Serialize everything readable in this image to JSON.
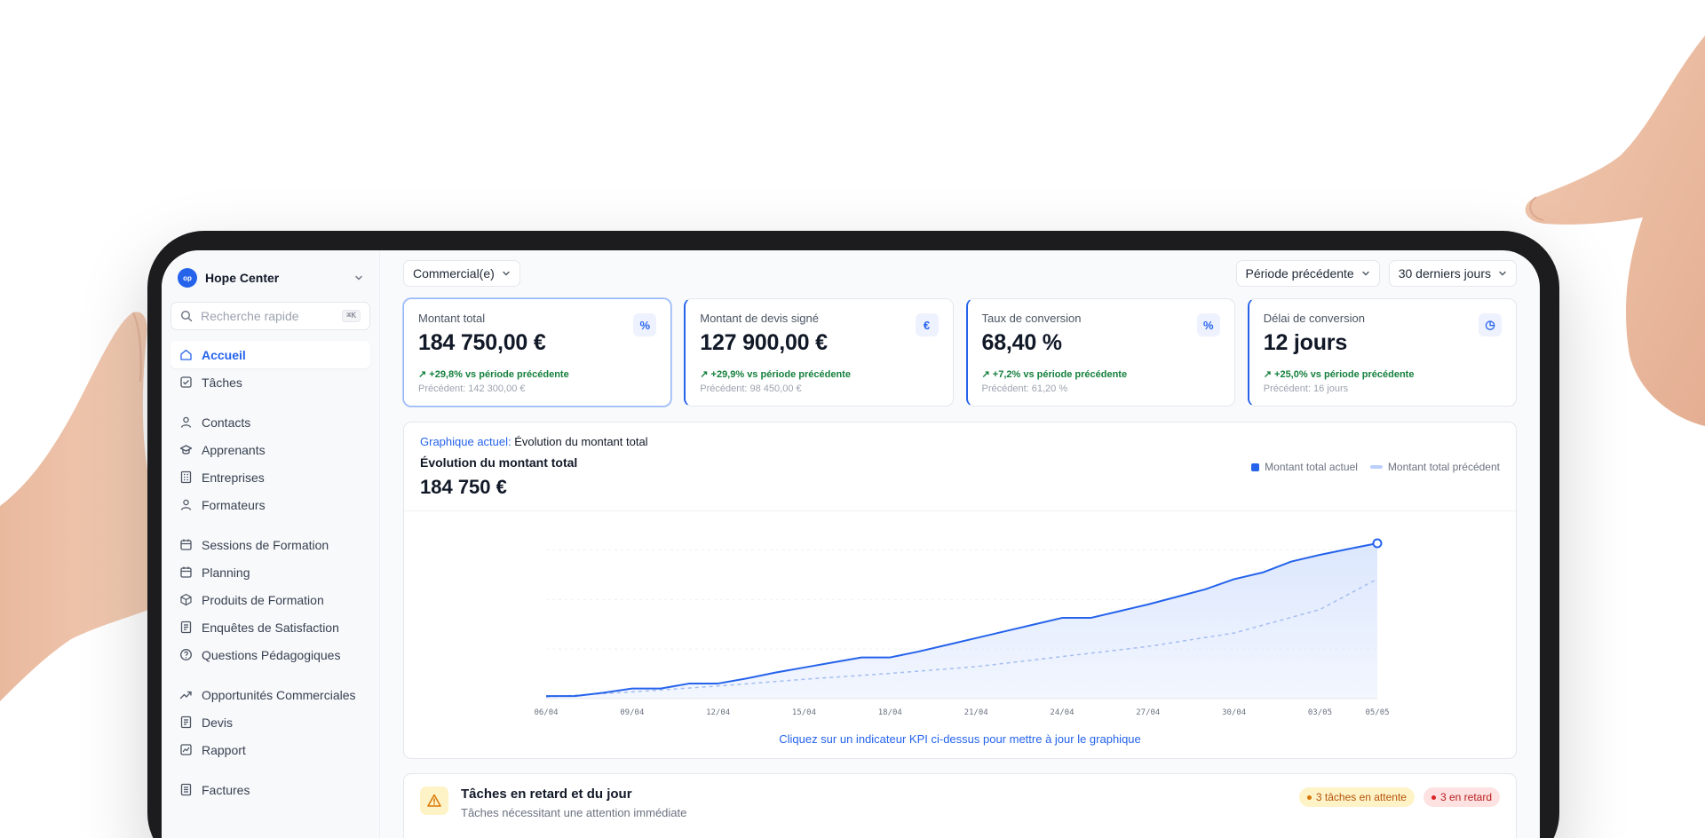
{
  "sidebar": {
    "org_logo": "op",
    "org_name": "Hope Center",
    "search_placeholder": "Recherche rapide",
    "search_shortcut": "⌘K",
    "groups": [
      [
        {
          "label": "Accueil",
          "icon": "home-icon",
          "active": true
        },
        {
          "label": "Tâches",
          "icon": "checkbox-icon"
        }
      ],
      [
        {
          "label": "Contacts",
          "icon": "user-icon"
        },
        {
          "label": "Apprenants",
          "icon": "graduation-cap-icon"
        },
        {
          "label": "Entreprises",
          "icon": "building-icon"
        },
        {
          "label": "Formateurs",
          "icon": "user-icon"
        }
      ],
      [
        {
          "label": "Sessions de Formation",
          "icon": "calendar-icon"
        },
        {
          "label": "Planning",
          "icon": "calendar-icon"
        },
        {
          "label": "Produits de Formation",
          "icon": "box-icon"
        },
        {
          "label": "Enquêtes de Satisfaction",
          "icon": "document-icon"
        },
        {
          "label": "Questions Pédagogiques",
          "icon": "help-circle-icon"
        }
      ],
      [
        {
          "label": "Opportunités Commerciales",
          "icon": "trending-up-icon"
        },
        {
          "label": "Devis",
          "icon": "document-icon"
        },
        {
          "label": "Rapport",
          "icon": "line-chart-icon"
        }
      ],
      [
        {
          "label": "Factures",
          "icon": "invoice-icon"
        }
      ]
    ]
  },
  "topbar": {
    "commercial_filter": "Commercial(e)",
    "compare_period": "Période précédente",
    "date_range": "30 derniers jours"
  },
  "kpis": [
    {
      "label": "Montant total",
      "value": "184 750,00 €",
      "delta": "↗ +29,8% vs période précédente",
      "previous": "Précédent: 142 300,00 €",
      "icon": "percent-icon",
      "icon_glyph": "%",
      "selected": true
    },
    {
      "label": "Montant de devis signé",
      "value": "127 900,00 €",
      "delta": "↗ +29,9% vs période précédente",
      "previous": "Précédent: 98 450,00 €",
      "icon": "euro-icon",
      "icon_glyph": "€",
      "selected": false
    },
    {
      "label": "Taux de conversion",
      "value": "68,40 %",
      "delta": "↗ +7,2% vs période précédente",
      "previous": "Précédent: 61,20 %",
      "icon": "percent-icon",
      "icon_glyph": "%",
      "selected": false
    },
    {
      "label": "Délai de conversion",
      "value": "12 jours",
      "delta": "↗ +25,0% vs période précédente",
      "previous": "Précédent: 16 jours",
      "icon": "clock-icon",
      "icon_glyph": "◷",
      "selected": false
    }
  ],
  "chart_panel": {
    "current_label": "Graphique actuel:",
    "current_value": "Évolution du montant total",
    "title": "Évolution du montant total",
    "total": "184 750 €",
    "hint": "Cliquez sur un indicateur KPI ci-dessus pour mettre à jour le graphique",
    "colors": {
      "current": "#2563eb",
      "previous": "#a5bdf0",
      "area": "#dbe6fd"
    }
  },
  "chart_data": {
    "type": "area",
    "x_tick_labels": [
      "06/04",
      "09/04",
      "12/04",
      "15/04",
      "18/04",
      "21/04",
      "24/04",
      "27/04",
      "30/04",
      "03/05",
      "05/05"
    ],
    "x_days": [
      0,
      3,
      6,
      9,
      12,
      15,
      18,
      21,
      24,
      27,
      29
    ],
    "ylim": [
      0,
      190000
    ],
    "grid": true,
    "legend_position": "top-right",
    "series": [
      {
        "name": "Montant total actuel",
        "x": [
          0,
          1,
          2,
          3,
          4,
          5,
          6,
          7,
          8,
          9,
          10,
          11,
          12,
          13,
          14,
          15,
          16,
          17,
          18,
          19,
          20,
          21,
          22,
          23,
          24,
          25,
          26,
          27,
          28,
          29
        ],
        "values": [
          3000,
          3000,
          7000,
          12000,
          12000,
          18000,
          18000,
          24000,
          31000,
          37000,
          43000,
          49000,
          49000,
          56000,
          64000,
          72000,
          80000,
          88000,
          96000,
          96000,
          104000,
          112000,
          121000,
          130000,
          142000,
          150000,
          163000,
          171000,
          178000,
          184750
        ]
      },
      {
        "name": "Montant total précédent",
        "x": [
          0,
          3,
          6,
          9,
          12,
          15,
          18,
          21,
          24,
          27,
          29
        ],
        "values": [
          2000,
          8000,
          15000,
          23000,
          30000,
          38000,
          50000,
          62000,
          78000,
          106000,
          142300
        ]
      }
    ]
  },
  "tasks": {
    "title": "Tâches en retard et du jour",
    "subtitle": "Tâches nécessitant une attention immédiate",
    "pending_badge": "3 tâches en attente",
    "overdue_badge": "3 en retard"
  }
}
